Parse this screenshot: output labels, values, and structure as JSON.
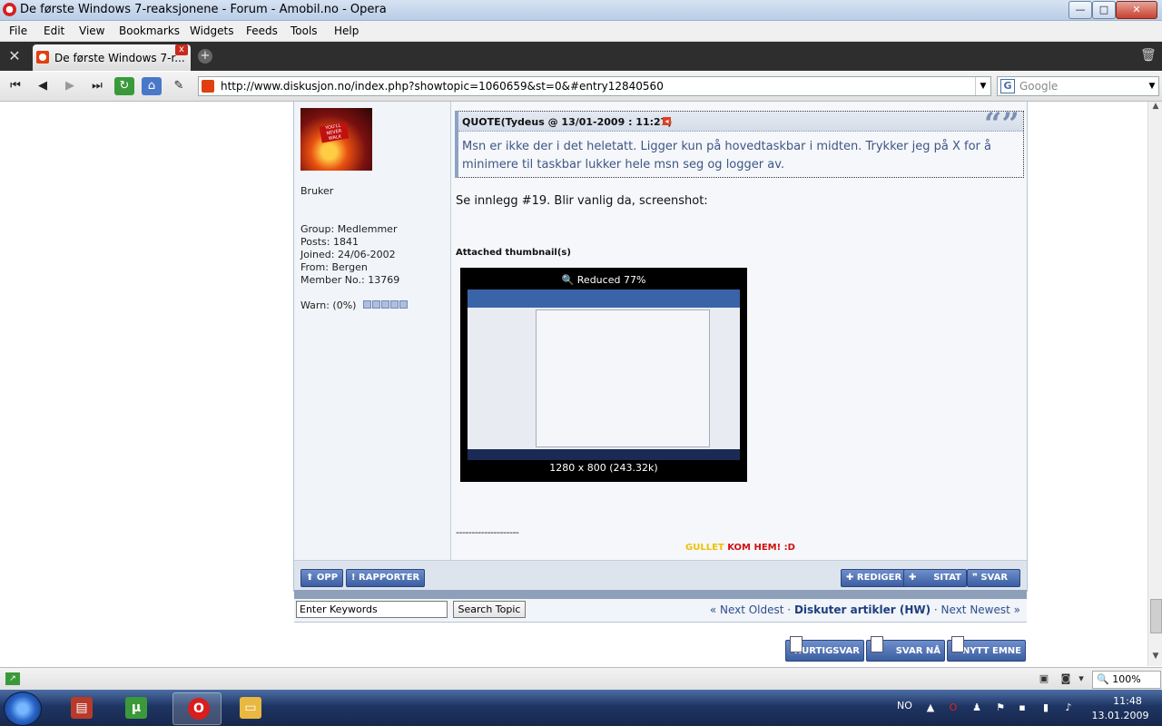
{
  "window": {
    "title": "De første Windows 7-reaksjonene - Forum - Amobil.no - Opera",
    "minimize": "—",
    "maximize": "□",
    "close": "✕"
  },
  "menu": [
    "File",
    "Edit",
    "View",
    "Bookmarks",
    "Widgets",
    "Feeds",
    "Tools",
    "Help"
  ],
  "tab": {
    "label": "De første Windows 7-r...",
    "close": "x",
    "add": "+"
  },
  "address": {
    "url": "http://www.diskusjon.no/index.php?showtopic=1060659&st=0&#entry12840560",
    "search_placeholder": "Google"
  },
  "profile": {
    "title": "Bruker",
    "group": "Group: Medlemmer",
    "posts": "Posts: 1841",
    "joined": "Joined: 24/06-2002",
    "from": "From: Bergen",
    "member_no": "Member No.: 13769",
    "warn": "Warn: (0%)"
  },
  "post": {
    "quote_header": "QUOTE(Tydeus @ 13/01-2009 : 11:27)",
    "quote_marks": "“”",
    "quote_line1": "Msn er ikke der i det heletatt. Ligger kun på hovedtaskbar i midten. Trykker jeg på X for å",
    "quote_line2": "minimere til taskbar lukker hele msn seg og logger av.",
    "body": "Se innlegg #19. Blir vanlig da, screenshot:",
    "attached_label": "Attached thumbnail(s)",
    "thumb_reduced": "Reduced 77%",
    "thumb_size": "1280 x 800 (243.32k)",
    "signature_line": "--------------------",
    "signature_a": "GULLET",
    "signature_b": "KOM HEM! :D"
  },
  "post_buttons": {
    "up": "OPP",
    "report": "RAPPORTER",
    "edit": "REDIGER",
    "quote": "SITAT",
    "reply": "SVAR"
  },
  "search": {
    "keywords_placeholder": "Enter Keywords",
    "search_button": "Search Topic"
  },
  "topic_nav": {
    "prev": "« Next Oldest",
    "sep1": " · ",
    "forum": "Diskuter artikler (HW)",
    "sep2": " · ",
    "next": "Next Newest »"
  },
  "reply_buttons": {
    "quick_reply": "HURTIGSVAR",
    "reply_now": "SVAR NÅ",
    "new_topic": "NYTT EMNE"
  },
  "statusbar": {
    "zoom": "100%"
  },
  "taskbar": {
    "language": "NO",
    "time": "11:48",
    "date": "13.01.2009"
  },
  "colors": {
    "accent_blue": "#3c5ea2",
    "quote_text": "#3e5684",
    "sig_gold": "#f0c000",
    "sig_red": "#d01010"
  }
}
